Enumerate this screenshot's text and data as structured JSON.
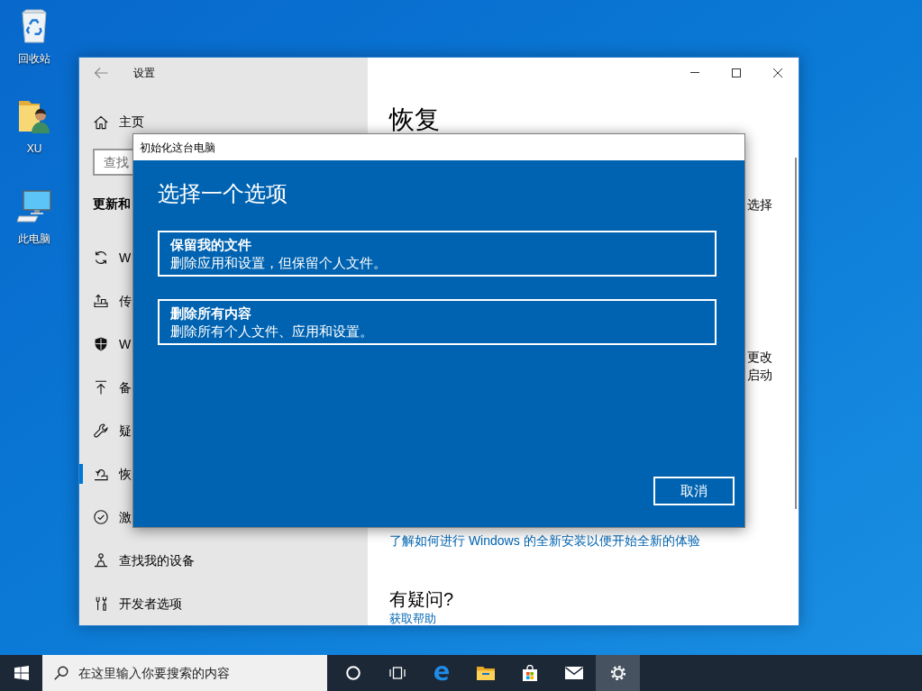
{
  "desktop": {
    "shortcuts": [
      {
        "kind": "recycle-bin",
        "label": "回收站"
      },
      {
        "kind": "user-folder",
        "label": "XU"
      },
      {
        "kind": "computer",
        "label": "此电脑"
      }
    ]
  },
  "settings_window": {
    "title": "设置",
    "sidebar": {
      "home": "主页",
      "search": {
        "placeholder": "查找"
      },
      "section_title": "更新和",
      "items": [
        {
          "kind": "sync",
          "label": "W",
          "selected": false
        },
        {
          "kind": "delivery",
          "label": "传",
          "selected": false
        },
        {
          "kind": "shield",
          "label": "W",
          "selected": false
        },
        {
          "kind": "backup",
          "label": "备",
          "selected": false
        },
        {
          "kind": "troubleshoot",
          "label": "疑",
          "selected": false
        },
        {
          "kind": "recovery",
          "label": "恢",
          "selected": true
        },
        {
          "kind": "activation",
          "label": "激",
          "selected": false
        },
        {
          "kind": "find-device",
          "label": "查找我的设备",
          "selected": false
        },
        {
          "kind": "developer",
          "label": "开发者选项",
          "selected": false
        }
      ]
    },
    "content": {
      "title": "恢复",
      "fragments": [
        "选择",
        "更改",
        "启动"
      ],
      "link": "了解如何进行 Windows 的全新安装以便开始全新的体验",
      "help_title": "有疑问?",
      "help_link": "获取帮助"
    }
  },
  "dialog": {
    "title": "初始化这台电脑",
    "heading": "选择一个选项",
    "options": [
      {
        "title": "保留我的文件",
        "description": "删除应用和设置，但保留个人文件。"
      },
      {
        "title": "删除所有内容",
        "description": "删除所有个人文件、应用和设置。"
      }
    ],
    "cancel": "取消"
  },
  "taskbar": {
    "search": {
      "placeholder": "在这里输入你要搜索的内容"
    },
    "apps": [
      {
        "kind": "cortana",
        "active": false
      },
      {
        "kind": "task-view",
        "active": false
      },
      {
        "kind": "browser",
        "active": false
      },
      {
        "kind": "explorer",
        "active": false
      },
      {
        "kind": "store",
        "active": false
      },
      {
        "kind": "mail",
        "active": false
      },
      {
        "kind": "settings",
        "active": true
      }
    ]
  }
}
